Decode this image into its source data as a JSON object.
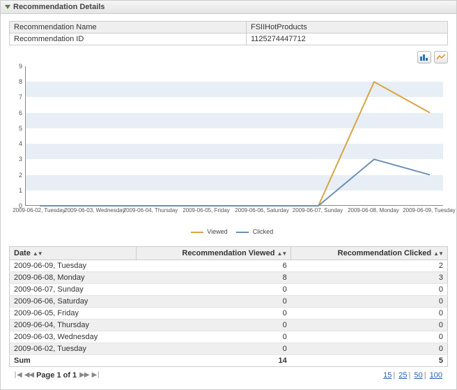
{
  "header": {
    "title": "Recommendation Details"
  },
  "meta": {
    "name_label": "Recommendation Name",
    "name_value": "FSIIHotProducts",
    "id_label": "Recommendation ID",
    "id_value": "1125274447712"
  },
  "toolbar": {
    "bar_icon": "bar-chart-icon",
    "line_icon": "line-chart-icon"
  },
  "chart_data": {
    "type": "line",
    "title": "",
    "xlabel": "",
    "ylabel": "",
    "ylim": [
      0,
      9
    ],
    "categories": [
      "2009-06-02, Tuesday",
      "2009-06-03, Wednesday",
      "2009-06-04, Thursday",
      "2009-06-05, Friday",
      "2009-06-06, Saturday",
      "2009-06-07, Sunday",
      "2009-06-08, Monday",
      "2009-06-09, Tuesday"
    ],
    "series": [
      {
        "name": "Viewed",
        "color": "#d9a441",
        "values": [
          0,
          0,
          0,
          0,
          0,
          0,
          8,
          6
        ]
      },
      {
        "name": "Clicked",
        "color": "#6b8fb5",
        "values": [
          0,
          0,
          0,
          0,
          0,
          0,
          3,
          2
        ]
      }
    ]
  },
  "legend": {
    "viewed": "Viewed",
    "clicked": "Clicked"
  },
  "grid": {
    "columns": {
      "date": "Date",
      "viewed": "Recommendation Viewed",
      "clicked": "Recommendation Clicked"
    },
    "rows": [
      {
        "date": "2009-06-09, Tuesday",
        "viewed": 6,
        "clicked": 2
      },
      {
        "date": "2009-06-08, Monday",
        "viewed": 8,
        "clicked": 3
      },
      {
        "date": "2009-06-07, Sunday",
        "viewed": 0,
        "clicked": 0
      },
      {
        "date": "2009-06-06, Saturday",
        "viewed": 0,
        "clicked": 0
      },
      {
        "date": "2009-06-05, Friday",
        "viewed": 0,
        "clicked": 0
      },
      {
        "date": "2009-06-04, Thursday",
        "viewed": 0,
        "clicked": 0
      },
      {
        "date": "2009-06-03, Wednesday",
        "viewed": 0,
        "clicked": 0
      },
      {
        "date": "2009-06-02, Tuesday",
        "viewed": 0,
        "clicked": 0
      }
    ],
    "sum_label": "Sum",
    "sum_viewed": 14,
    "sum_clicked": 5
  },
  "pager": {
    "label": "Page 1 of 1"
  },
  "pagesize": {
    "p15": "15",
    "p25": "25",
    "p50": "50",
    "p100": "100"
  }
}
